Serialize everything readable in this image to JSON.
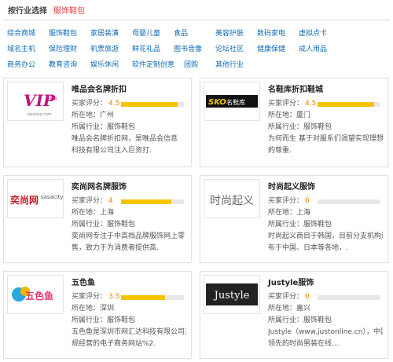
{
  "header": {
    "title": "按行业选择",
    "current": "服饰鞋包"
  },
  "categories": [
    [
      "综合商城",
      "服饰鞋包",
      "家居装潢",
      "母婴儿童",
      "食品",
      "美容护肤",
      "数码家电",
      "虚拟点卡"
    ],
    [
      "域名主机",
      "保险理财",
      "机票旅游",
      "鲜花礼品",
      "图书音像",
      "论坛社区",
      "健康保健",
      "成人用品"
    ],
    [
      "商务办公",
      "教育咨询",
      "娱乐休闲",
      "软件定制创意",
      "团购",
      "其他行业"
    ]
  ],
  "cards": [
    {
      "name": "唯品会名牌折扣",
      "rating_label": "买家评分：",
      "score": "4.5",
      "location": "所在地：广州",
      "industry": "所属行业：服饰鞋包",
      "desc": [
        "唯品会名牌折扣网，是唯品会信息",
        "科技有限公司注入巨资打."
      ],
      "logo_text": "VIP",
      "logo_sub": "vipshop.com",
      "accent": "#c2127e"
    },
    {
      "name": "名鞋库折扣鞋城",
      "rating_label": "买家评分：",
      "score": "4.5",
      "location": "所在地：厦门",
      "industry": "所属行业：服饰鞋包",
      "desc": [
        "为何而生 基于对服系们渴望实现理想",
        "的尊重."
      ],
      "logo_text": "SKOmall",
      "logo_sub": "名鞋库",
      "accent": "#1a1a1a"
    },
    {
      "name": "奕尚网名牌服饰",
      "rating_label": "买家评分：",
      "score": "4",
      "location": "所在地：上海",
      "industry": "所属行业：服饰鞋包",
      "desc": [
        "奕尚网专注于中高档品牌服饰网上零",
        "售，致力于为消费者提供高."
      ],
      "logo_text": "奕尚网",
      "logo_sub": "sasacity",
      "accent": "#c3202a"
    },
    {
      "name": "时尚起义服饰",
      "rating_label": "买家评分：",
      "score": "0",
      "location": "所在地：上海",
      "industry": "所属行业：服饰鞋包",
      "desc": [
        "时尚起义商目于韩国，目前分支机构遍",
        "布于中国、日本等各地，."
      ],
      "logo_text": "时尚起义",
      "logo_sub": "",
      "accent": "#666666"
    },
    {
      "name": "五色鱼",
      "rating_label": "买家评分：",
      "score": "3.5",
      "location": "所在地：深圳",
      "industry": "所属行业：服饰鞋包",
      "desc": [
        "五色鱼是深圳市网汇达科技有限公司正",
        "规经营的电子商务网站%2."
      ],
      "logo_text": "五色鱼",
      "logo_sub": "",
      "accent": "#e23a6e"
    },
    {
      "name": "Justyle服饰",
      "rating_label": "买家评分：",
      "score": "0",
      "location": "所在地：嘉兴",
      "industry": "所属行业：服饰鞋包",
      "desc": [
        "Justyle（www.justonline.cn），中国",
        "领先的时尚男装在线...."
      ],
      "logo_text": "Justyle",
      "logo_sub": "",
      "accent": "#222222"
    }
  ]
}
